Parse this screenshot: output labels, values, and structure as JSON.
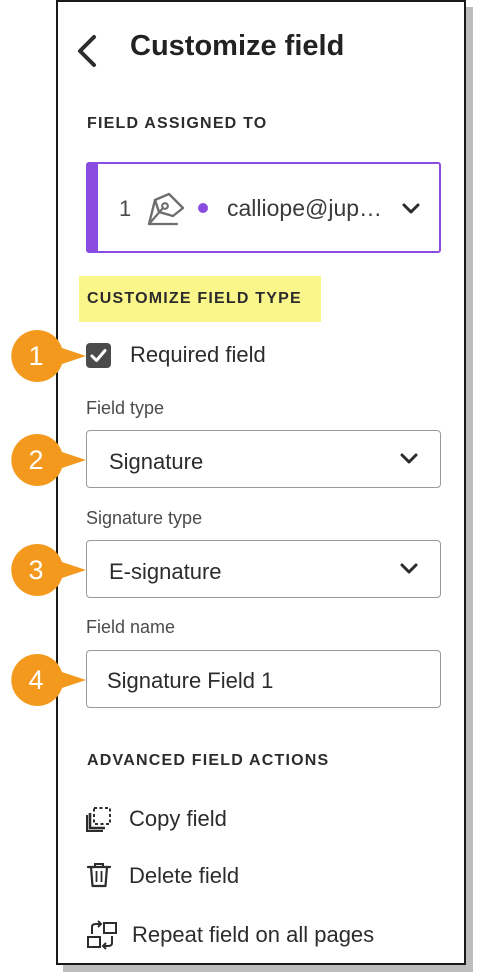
{
  "header": {
    "title": "Customize field"
  },
  "assigned": {
    "label": "FIELD ASSIGNED TO",
    "number": "1",
    "email": "calliope@jup…",
    "accent_color": "#8a4be0"
  },
  "customize": {
    "label": "CUSTOMIZE FIELD TYPE",
    "highlight_color": "#fbf68a",
    "required_label": "Required field",
    "required_checked": true
  },
  "field_type": {
    "label": "Field type",
    "value": "Signature"
  },
  "signature_type": {
    "label": "Signature type",
    "value": "E-signature"
  },
  "field_name": {
    "label": "Field name",
    "value": "Signature Field 1"
  },
  "advanced": {
    "label": "ADVANCED FIELD ACTIONS",
    "copy": "Copy field",
    "delete": "Delete field",
    "repeat": "Repeat field on all pages"
  },
  "callouts": {
    "c1": "1",
    "c2": "2",
    "c3": "3",
    "c4": "4",
    "color": "#f39a1e"
  }
}
